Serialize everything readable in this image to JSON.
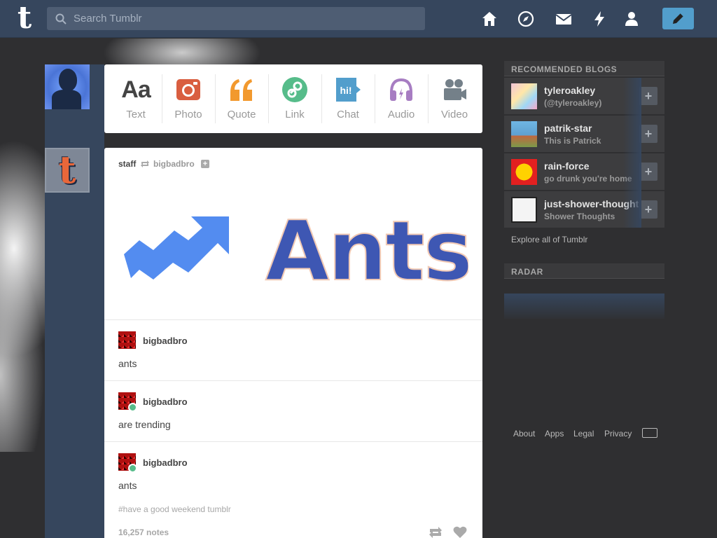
{
  "header": {
    "logo_text": "t",
    "search_placeholder": "Search Tumblr",
    "nav_icons": [
      "home-icon",
      "explore-compass-icon",
      "inbox-mail-icon",
      "activity-lightning-icon",
      "account-person-icon"
    ],
    "compose_icon": "pencil-icon"
  },
  "post_types": [
    {
      "label": "Text",
      "icon": "text-aa-icon",
      "color": "#444444"
    },
    {
      "label": "Photo",
      "icon": "camera-icon",
      "color": "#d95e40"
    },
    {
      "label": "Quote",
      "icon": "quote-icon",
      "color": "#f2992e"
    },
    {
      "label": "Link",
      "icon": "link-icon",
      "color": "#56bc8a"
    },
    {
      "label": "Chat",
      "icon": "chat-bubble-icon",
      "color": "#529ecc"
    },
    {
      "label": "Audio",
      "icon": "headphones-icon",
      "color": "#a77dc2"
    },
    {
      "label": "Video",
      "icon": "video-camera-icon",
      "color": "#748089"
    }
  ],
  "chat_icon_text": "hi!",
  "text_icon_text": "Aa",
  "post": {
    "author": "staff",
    "via": "bigbadbro",
    "image_text": "Ants",
    "reblogs": [
      {
        "name": "bigbadbro",
        "text": "ants"
      },
      {
        "name": "bigbadbro",
        "text": "are trending"
      },
      {
        "name": "bigbadbro",
        "text": "ants"
      }
    ],
    "tags": "#have a good weekend tumblr",
    "notes": "16,257 notes"
  },
  "sidebar": {
    "recommended_title": "RECOMMENDED BLOGS",
    "blogs": [
      {
        "name": "tyleroakley",
        "title": "(@tyleroakley)"
      },
      {
        "name": "patrik-star",
        "title": "This is Patrick"
      },
      {
        "name": "rain-force",
        "title": "go drunk you're home"
      },
      {
        "name": "just-shower-thoughts",
        "title": "Shower Thoughts"
      }
    ],
    "follow_label": "+",
    "explore_link": "Explore all of Tumblr",
    "radar_title": "RADAR",
    "footer_links": [
      "About",
      "Apps",
      "Legal",
      "Privacy"
    ]
  },
  "colors": {
    "header_bg": "#36465d",
    "page_bg": "#2f2f31",
    "accent_blue": "#529ecc"
  }
}
